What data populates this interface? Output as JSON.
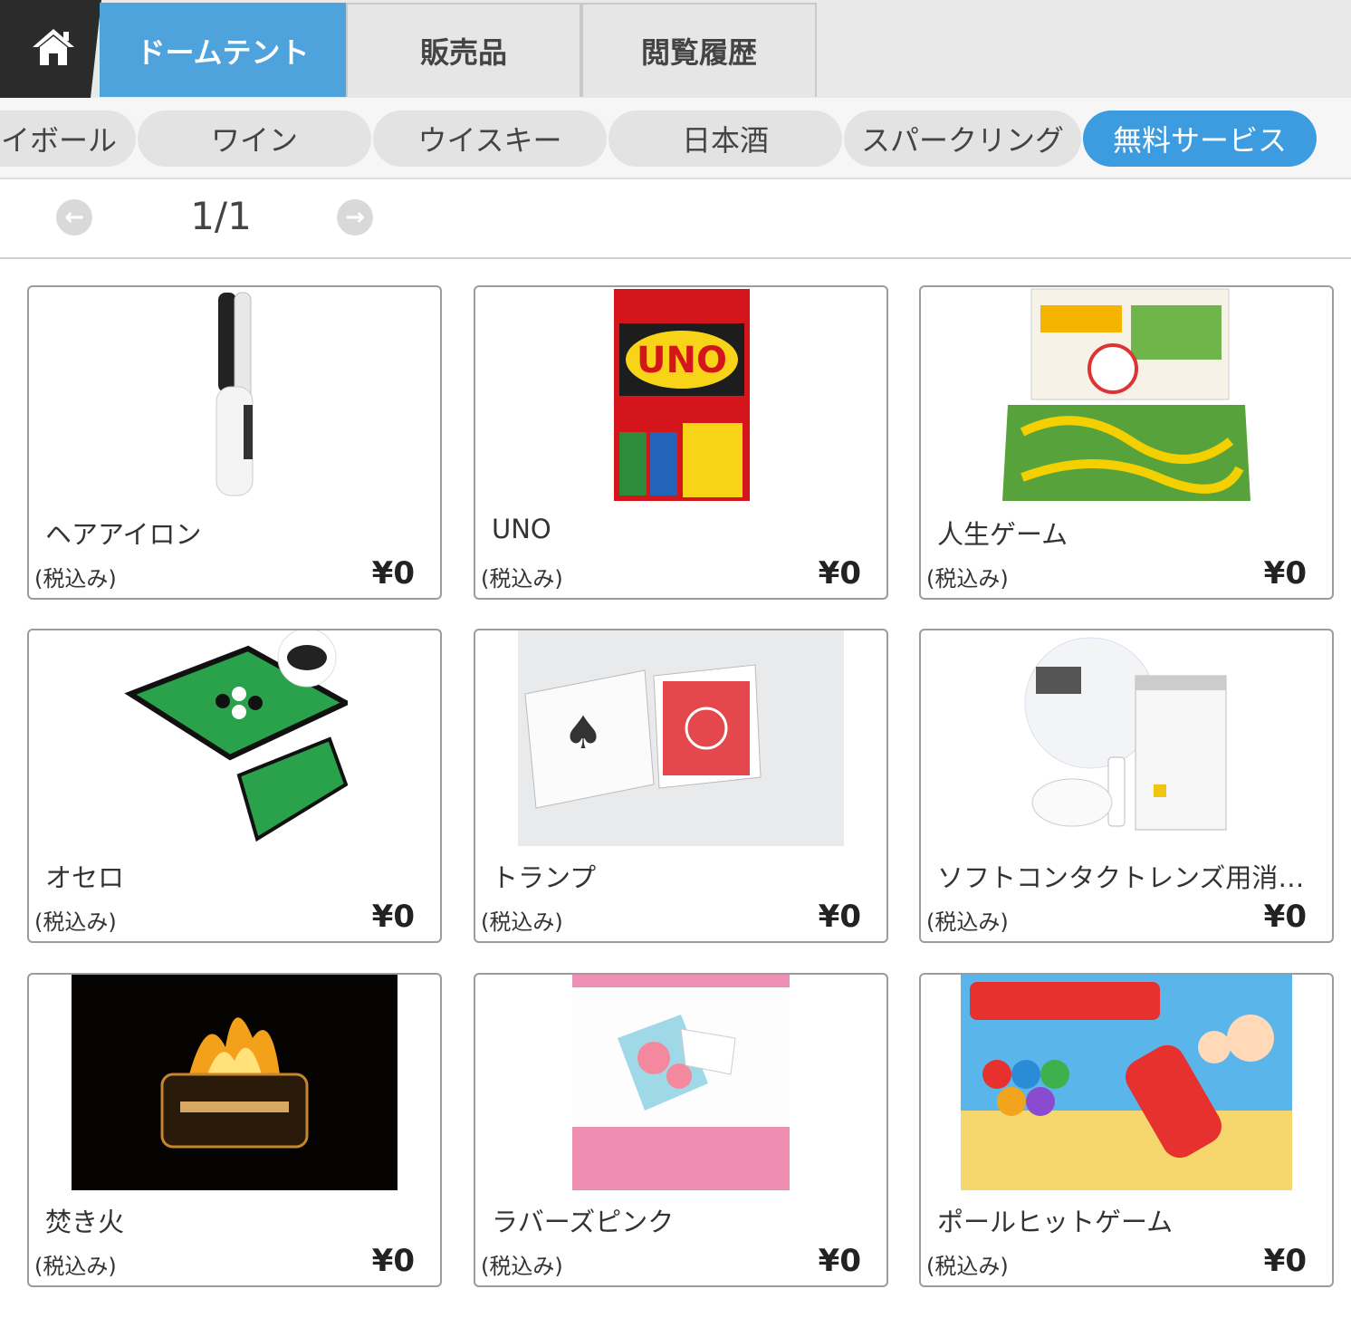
{
  "nav": {
    "home_icon": "home-icon",
    "tabs": [
      {
        "label": "ドームテント",
        "active": true
      },
      {
        "label": "販売品",
        "active": false
      },
      {
        "label": "閲覧履歴",
        "active": false
      }
    ],
    "accent_color": "#4ea3dc"
  },
  "categories": [
    {
      "label": "イボール",
      "active": false
    },
    {
      "label": "ワイン",
      "active": false
    },
    {
      "label": "ウイスキー",
      "active": false
    },
    {
      "label": "日本酒",
      "active": false
    },
    {
      "label": "スパークリング",
      "active": false
    },
    {
      "label": "無料サービス",
      "active": true
    }
  ],
  "pager": {
    "prev_icon": "arrow-left-icon",
    "next_icon": "arrow-right-icon",
    "page_text": "1/1"
  },
  "products": [
    {
      "name": "ヘアアイロン",
      "tax": "(税込み)",
      "price": "¥0",
      "image": "hair-iron-image"
    },
    {
      "name": "UNO",
      "tax": "(税込み)",
      "price": "¥0",
      "image": "uno-cards-image"
    },
    {
      "name": "人生ゲーム",
      "tax": "(税込み)",
      "price": "¥0",
      "image": "game-of-life-image"
    },
    {
      "name": "オセロ",
      "tax": "(税込み)",
      "price": "¥0",
      "image": "othello-board-image"
    },
    {
      "name": "トランプ",
      "tax": "(税込み)",
      "price": "¥0",
      "image": "playing-cards-image"
    },
    {
      "name": "ソフトコンタクトレンズ用消…",
      "tax": "(税込み)",
      "price": "¥0",
      "image": "contact-lens-kit-image"
    },
    {
      "name": "焚き火",
      "tax": "(税込み)",
      "price": "¥0",
      "image": "bonfire-image"
    },
    {
      "name": "ラバーズピンク",
      "tax": "(税込み)",
      "price": "¥0",
      "image": "lovers-pink-image"
    },
    {
      "name": "ポールヒットゲーム",
      "tax": "(税込み)",
      "price": "¥0",
      "image": "pole-hit-game-image"
    }
  ]
}
